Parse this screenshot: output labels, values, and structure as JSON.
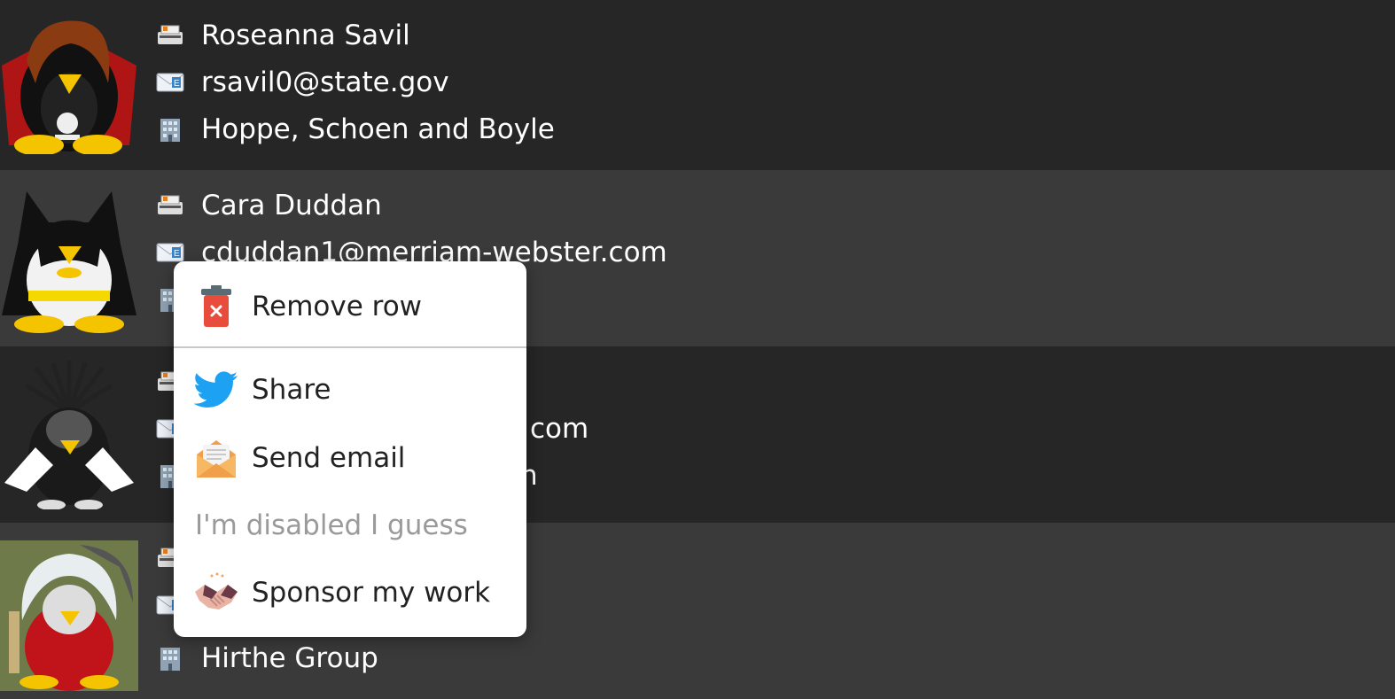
{
  "contacts": [
    {
      "name": "Roseanna Savil",
      "email": "rsavil0@state.gov",
      "company": "Hoppe, Schoen and Boyle",
      "avatar": "pirate-penguin-avatar"
    },
    {
      "name": "Cara Duddan",
      "email": "cduddan1@merriam-webster.com",
      "company": "",
      "avatar": "batman-penguin-avatar"
    },
    {
      "name": "",
      "email": "com",
      "company": "n",
      "avatar": "samurai-penguin-avatar"
    },
    {
      "name": "",
      "email": "",
      "company": "Hirthe Group",
      "avatar": "white-hair-penguin-avatar"
    }
  ],
  "row_icons": {
    "name": "name-badge-icon",
    "email": "email-envelope-icon",
    "company": "office-building-icon"
  },
  "context_menu": {
    "items": [
      {
        "label": "Remove row",
        "icon": "trash-can-icon",
        "enabled": true
      },
      {
        "label": "Share",
        "icon": "twitter-bird-icon",
        "enabled": true
      },
      {
        "label": "Send email",
        "icon": "open-envelope-icon",
        "enabled": true
      },
      {
        "label": "I'm disabled I guess",
        "icon": "",
        "enabled": false
      },
      {
        "label": "Sponsor my work",
        "icon": "handshake-icon",
        "enabled": true
      }
    ]
  },
  "colors": {
    "row_dark": "#262626",
    "row_light": "#3a3a3a",
    "text": "#ffffff",
    "menu_bg": "#ffffff",
    "menu_text": "#222222",
    "menu_disabled": "#9a9a9a",
    "twitter_blue": "#1da1f2",
    "trash_red": "#e74c3c"
  }
}
